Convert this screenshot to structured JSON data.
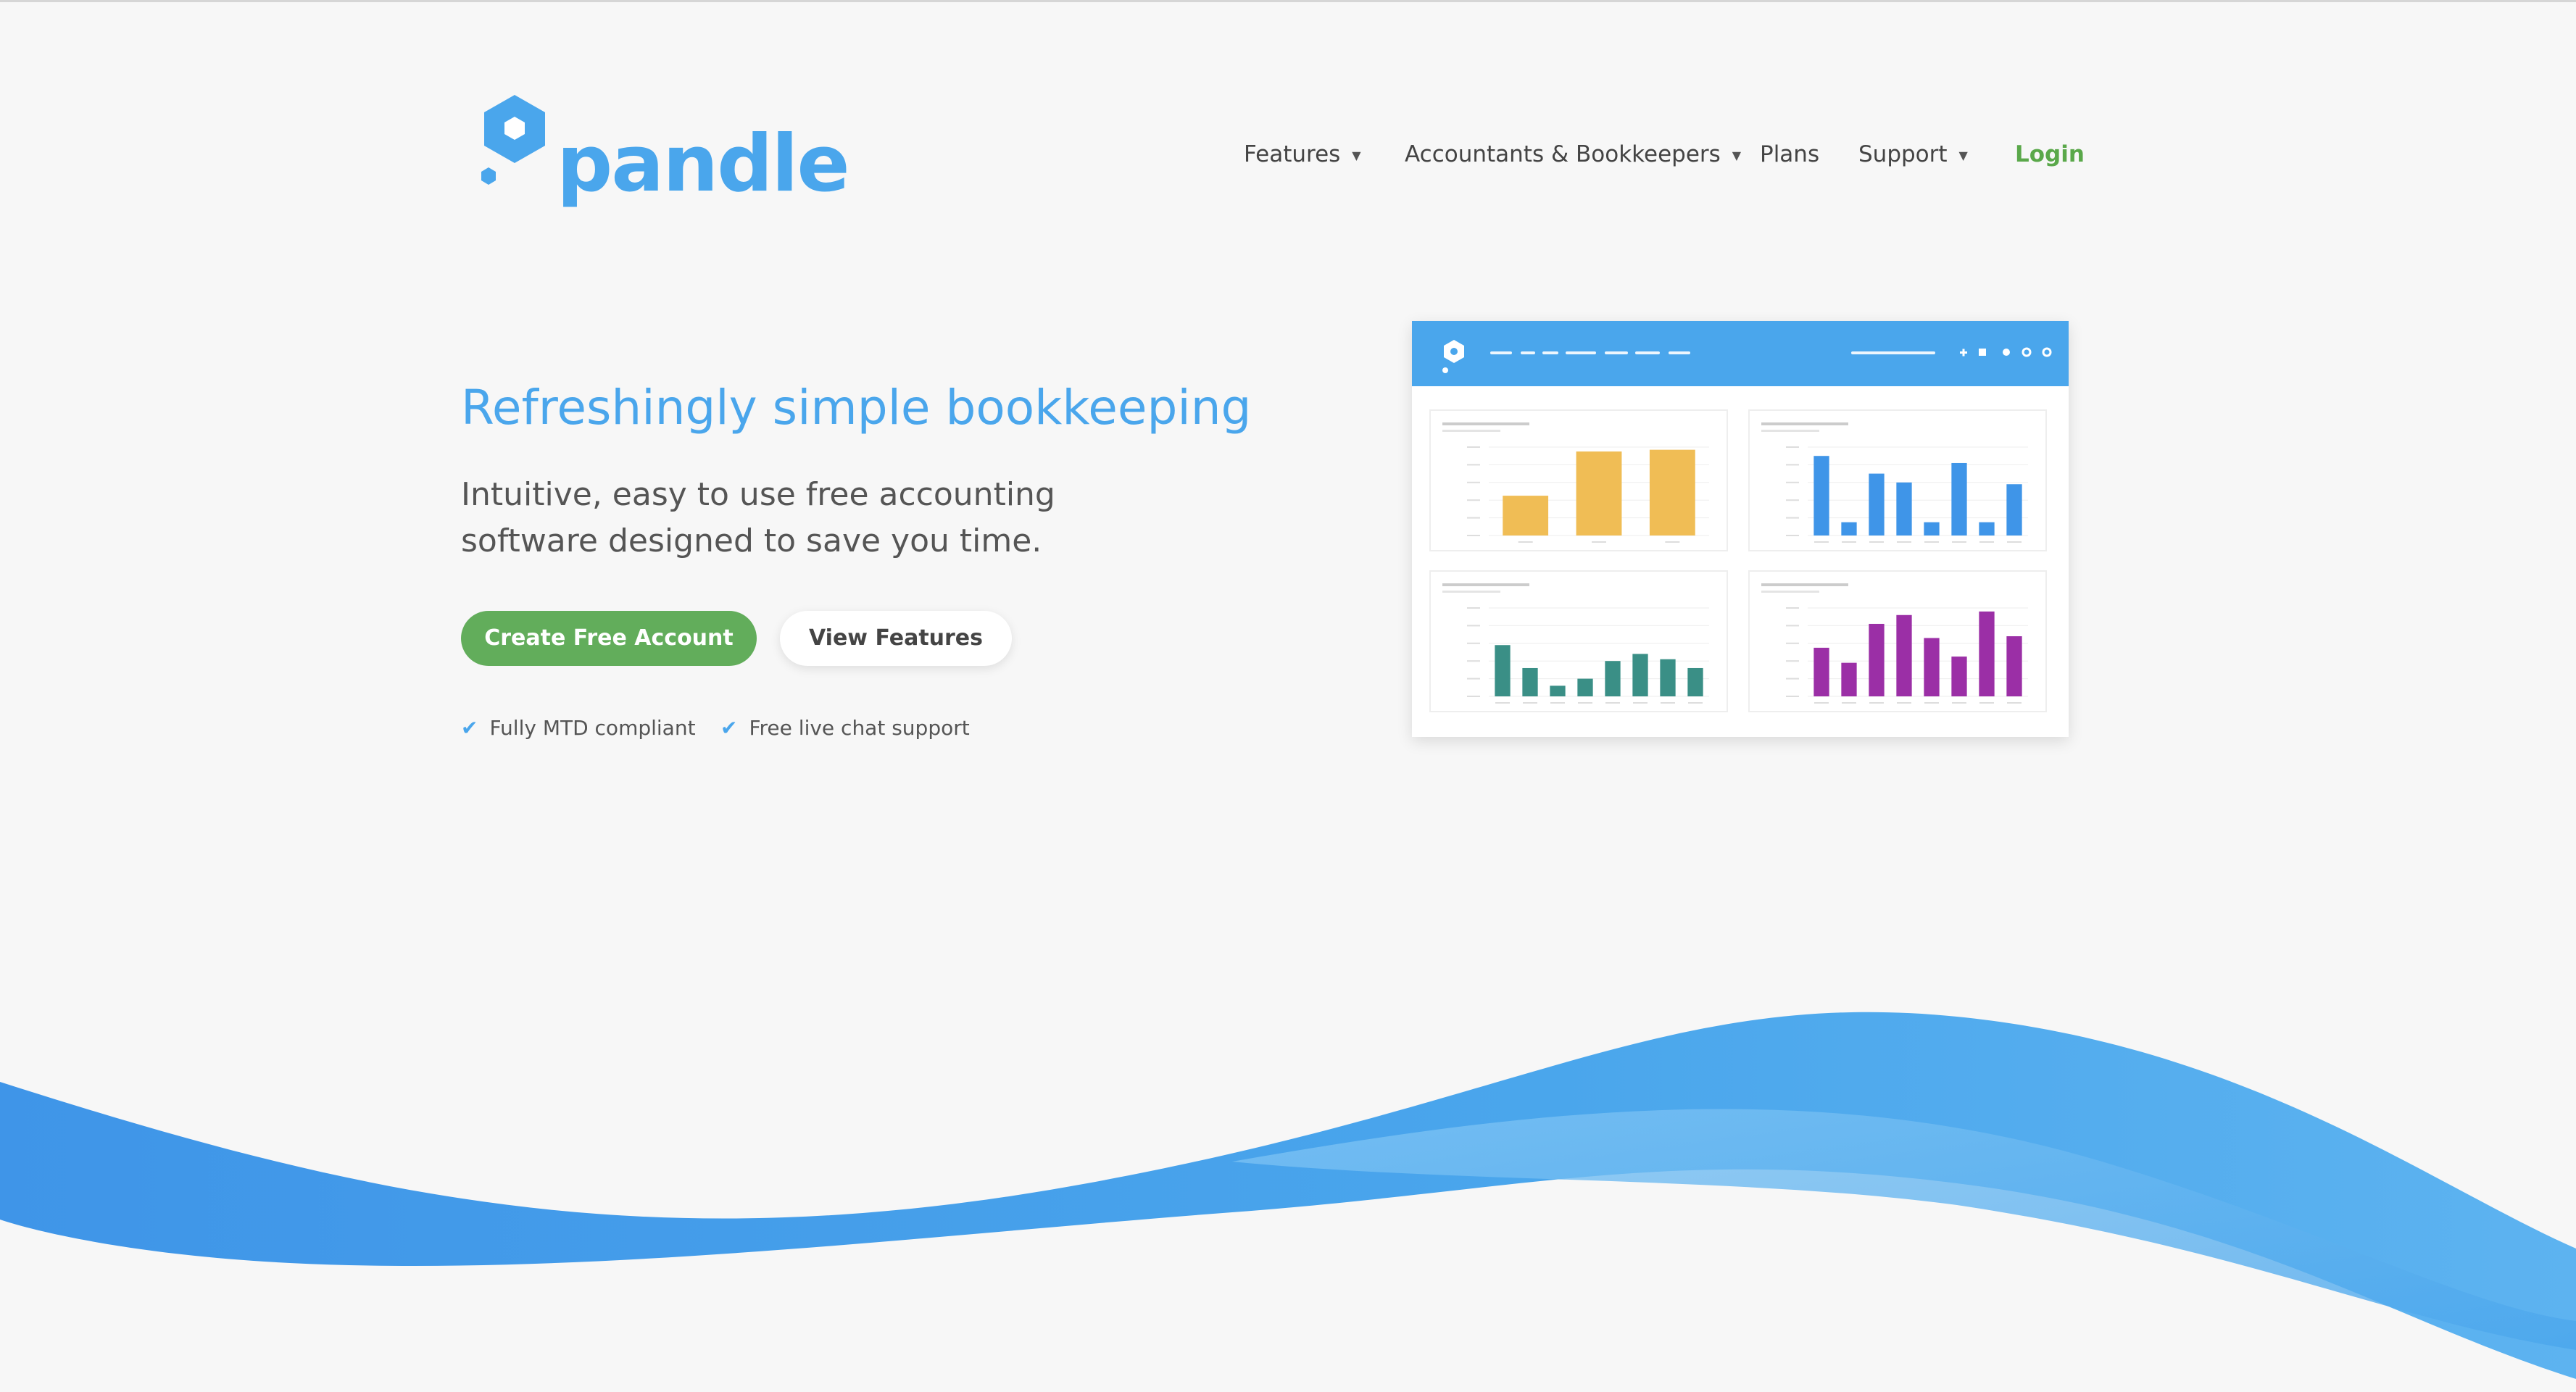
{
  "brand": {
    "name": "pandle",
    "color": "#4aa6ec"
  },
  "nav": {
    "items": [
      {
        "label": "Features",
        "has_dropdown": true
      },
      {
        "label": "Accountants & Bookkeepers",
        "has_dropdown": true
      },
      {
        "label": "Plans",
        "has_dropdown": false
      },
      {
        "label": "Support",
        "has_dropdown": true
      }
    ],
    "login_label": "Login"
  },
  "hero": {
    "title": "Refreshingly simple bookkeeping",
    "subtitle_line1": "Intuitive, easy to use free accounting",
    "subtitle_line2": "software designed to save you time.",
    "primary_cta": "Create Free Account",
    "secondary_cta": "View Features",
    "checks": [
      "Fully MTD compliant",
      "Free live chat support"
    ]
  },
  "dashboard_preview": {
    "panels": [
      {
        "color": "#f0bd55",
        "values": [
          0.45,
          0.95,
          0.97
        ]
      },
      {
        "color": "#3f95e8",
        "values": [
          0.9,
          0.15,
          0.7,
          0.6,
          0.15,
          0.82,
          0.15,
          0.58
        ]
      },
      {
        "color": "#3a8f86",
        "values": [
          0.58,
          0.32,
          0.12,
          0.2,
          0.4,
          0.48,
          0.42,
          0.32
        ]
      },
      {
        "color": "#9b2fa6",
        "values": [
          0.55,
          0.38,
          0.82,
          0.92,
          0.66,
          0.45,
          0.96,
          0.68
        ]
      }
    ]
  },
  "colors": {
    "accent": "#4aa6ec",
    "cta": "#62ad5b",
    "login": "#5aa84a",
    "wave": "#3f95e8"
  }
}
